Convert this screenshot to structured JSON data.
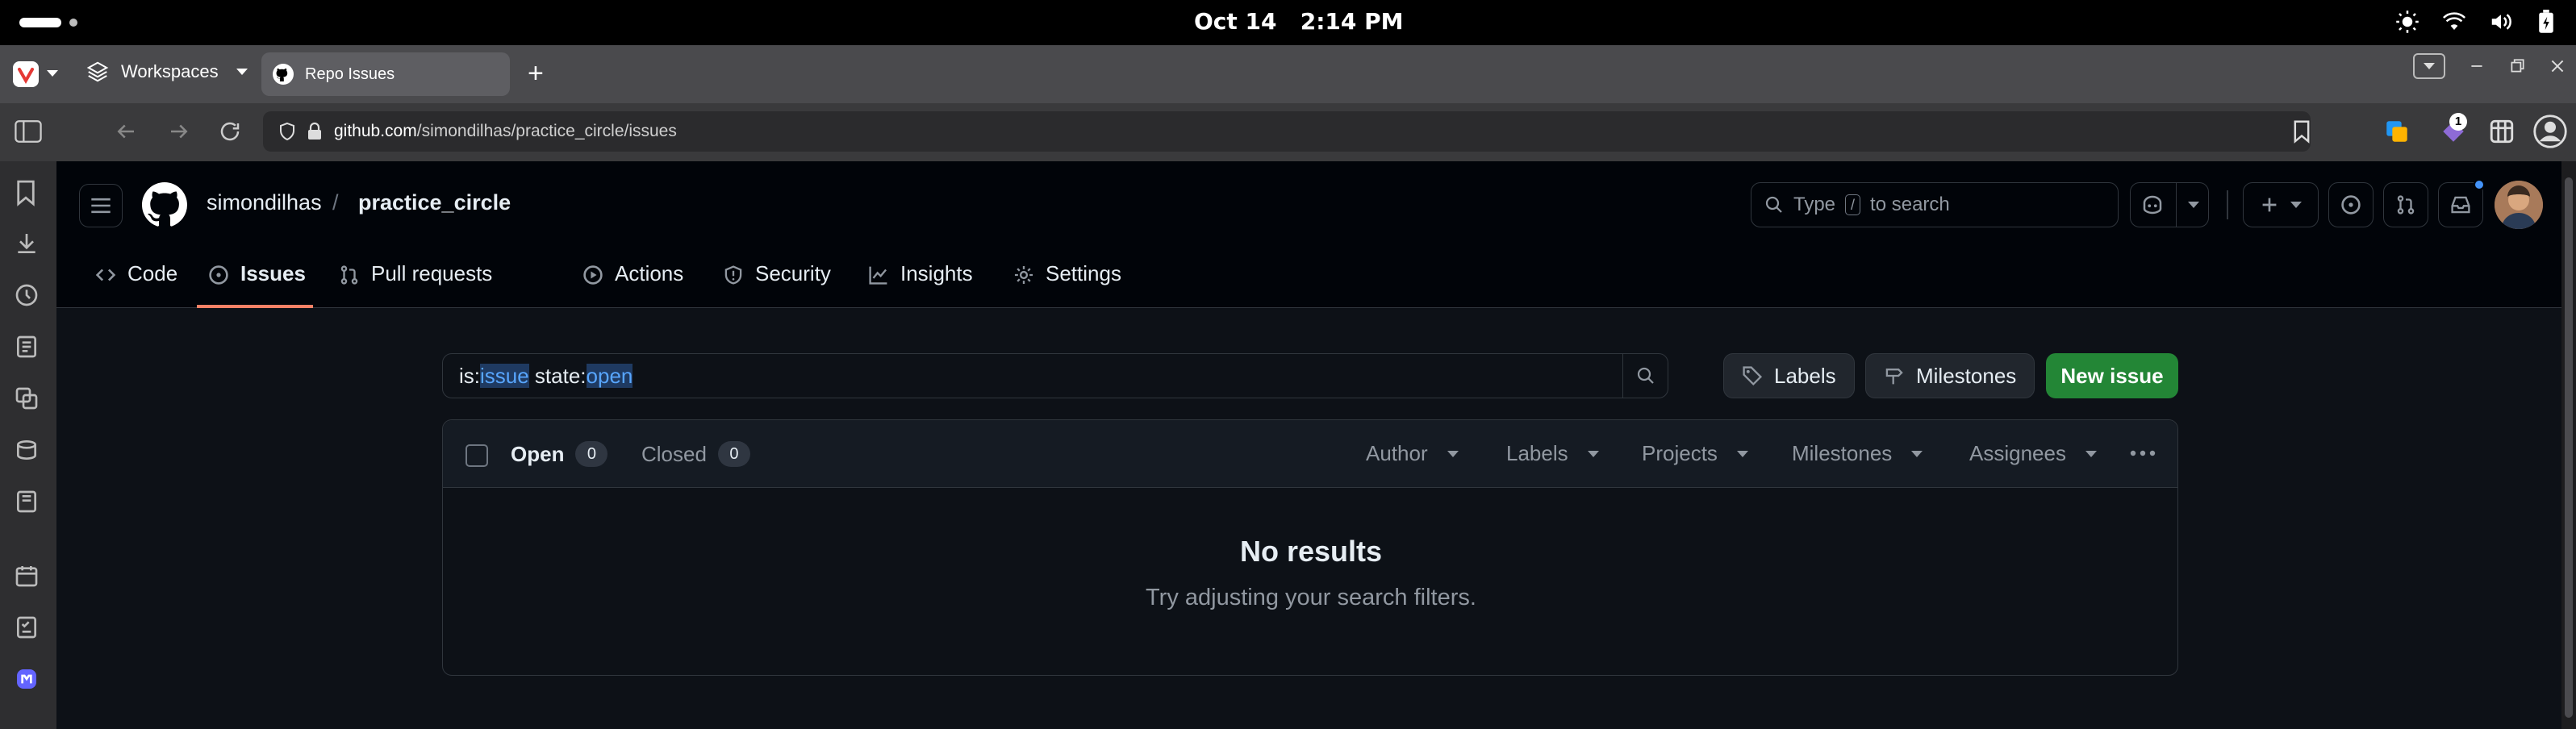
{
  "os": {
    "date": "Oct 14",
    "time": "2:14 PM"
  },
  "browser": {
    "workspaces_label": "Workspaces",
    "tab_title": "Repo Issues",
    "url_host": "github.com",
    "url_path": "/simondilhas/practice_circle/issues",
    "extension_badge": "1"
  },
  "github": {
    "owner": "simondilhas",
    "separator": "/",
    "repo": "practice_circle",
    "search": {
      "prefix": "Type",
      "key": "/",
      "suffix": "to search"
    },
    "nav": [
      {
        "label": "Code",
        "icon": "code-icon"
      },
      {
        "label": "Issues",
        "icon": "issue-opened-icon",
        "active": true
      },
      {
        "label": "Pull requests",
        "icon": "git-pull-request-icon"
      },
      {
        "label": "Actions",
        "icon": "play-icon"
      },
      {
        "label": "Security",
        "icon": "shield-icon"
      },
      {
        "label": "Insights",
        "icon": "graph-icon"
      },
      {
        "label": "Settings",
        "icon": "gear-icon"
      }
    ]
  },
  "issues": {
    "query": {
      "p1": "is:",
      "p2": "issue",
      "p3": " state:",
      "p4": "open"
    },
    "labels_button": "Labels",
    "milestones_button": "Milestones",
    "new_issue_button": "New issue",
    "open_label": "Open",
    "open_count": "0",
    "closed_label": "Closed",
    "closed_count": "0",
    "filters": {
      "author": "Author",
      "labels": "Labels",
      "projects": "Projects",
      "milestones": "Milestones",
      "assignees": "Assignees"
    },
    "empty_title": "No results",
    "empty_subtitle": "Try adjusting your search filters."
  },
  "colors": {
    "background": "#0d1117",
    "header_bg": "#010409",
    "primary_green": "#238636",
    "active_underline": "#f78166",
    "query_highlight": "#58a6ff"
  }
}
